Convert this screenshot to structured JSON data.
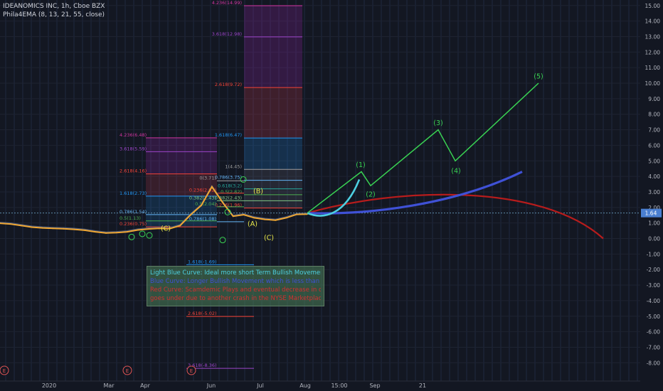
{
  "header": {
    "symbol": "IDEANOMICS INC, 1h, Cboe BZX",
    "indicator": "Phila4EMA (8, 13, 21, 55, close)"
  },
  "price_label": "1.64",
  "note": {
    "line1": "Light Blue Curve: Ideal more short Term Bullish Movement",
    "line2": "Blue Curve: Longer Bullish Movement which is less than ideal",
    "line3": "Red Curve: Scamdemic Plays and eventual decrease in company",
    "line4": "goes under due to another crash in the NYSE Marketplace",
    "color1": "#4dd0e1",
    "color2": "#3f51d6",
    "color3": "#d32f2f"
  },
  "chart_data": {
    "type": "line",
    "y_axis": {
      "ticks": [
        "15.00",
        "14.00",
        "13.00",
        "12.00",
        "11.00",
        "10.00",
        "9.00",
        "8.00",
        "7.00",
        "6.00",
        "5.00",
        "4.00",
        "3.00",
        "2.00",
        "1.00",
        "0.00",
        "-1.00",
        "-2.00",
        "-3.00",
        "-4.00",
        "-5.00",
        "-6.00",
        "-7.00",
        "-8.00"
      ],
      "ylim": [
        -8.6,
        15.3
      ]
    },
    "x_axis": {
      "ticks": [
        "2020",
        "Mar",
        "Apr",
        "Jun",
        "Jul",
        "Aug",
        "15:00",
        "Sep",
        "21"
      ]
    },
    "series": [
      {
        "values": [
          1.05,
          1.0,
          0.9,
          0.8,
          0.75,
          0.72,
          0.7,
          0.66,
          0.6,
          0.5,
          0.42,
          0.45,
          0.5,
          0.62,
          0.68,
          0.72,
          0.7,
          0.9,
          1.6,
          2.2,
          3.4,
          2.4,
          1.5,
          1.6,
          1.4,
          1.3,
          1.25,
          1.4,
          1.62,
          1.64
        ],
        "color": "#f0a733"
      }
    ],
    "projections": [
      {
        "color": "#39d353",
        "points": [
          [
            "Aug",
            1.64
          ],
          [
            "(1)",
            4.3
          ],
          [
            "(2)",
            3.4
          ],
          [
            "(3)",
            7.0
          ],
          [
            "(4)",
            5.0
          ],
          [
            "(5)",
            10.0
          ]
        ]
      },
      {
        "color": "#4dd0e1",
        "points": []
      },
      {
        "color": "#3f51d6",
        "points": []
      },
      {
        "color": "#b71c1c",
        "points": []
      }
    ],
    "wave_labels": [
      {
        "text": "(1)",
        "value": 4.6,
        "color": "#39d353"
      },
      {
        "text": "(2)",
        "value": 2.7,
        "color": "#39d353"
      },
      {
        "text": "(3)",
        "value": 7.3,
        "color": "#39d353"
      },
      {
        "text": "(4)",
        "value": 4.2,
        "color": "#39d353"
      },
      {
        "text": "(5)",
        "value": 10.3,
        "color": "#39d353"
      },
      {
        "text": "(A)",
        "value": 0.8,
        "color": "#e8e84a"
      },
      {
        "text": "(B)",
        "value": 2.9,
        "color": "#e8e84a"
      },
      {
        "text": "(C)",
        "value": 0.5,
        "color": "#e8e84a"
      },
      {
        "text": "(C)",
        "value": -0.1,
        "color": "#e8e84a"
      }
    ],
    "fib_left": [
      {
        "text": "4.236(6.48)",
        "value": 6.48,
        "color": "#d0359f"
      },
      {
        "text": "3.618(5.59)",
        "value": 5.59,
        "color": "#9c45c9"
      },
      {
        "text": "2.618(4.16)",
        "value": 4.16,
        "color": "#f44336"
      },
      {
        "text": "1.618(2.73)",
        "value": 2.73,
        "color": "#2196f3"
      },
      {
        "text": "0.786(1.54)",
        "value": 1.54,
        "color": "#64b5f6"
      },
      {
        "text": "0.5(1.13)",
        "value": 1.13,
        "color": "#4caf50"
      },
      {
        "text": "0.236(0.75)",
        "value": 0.75,
        "color": "#f44336"
      }
    ],
    "fib_right": [
      {
        "text": "4.236(14.99)",
        "value": 14.99,
        "color": "#d0359f"
      },
      {
        "text": "3.618(12.98)",
        "value": 12.98,
        "color": "#9c45c9"
      },
      {
        "text": "2.618(9.72)",
        "value": 9.72,
        "color": "#f44336"
      },
      {
        "text": "1.618(6.47)",
        "value": 6.47,
        "color": "#2196f3"
      },
      {
        "text": "1(4.45)",
        "value": 4.45,
        "color": "#9e9e9e"
      },
      {
        "text": "0.786(3.75)",
        "value": 3.75,
        "color": "#64b5f6"
      },
      {
        "text": "0.618(3.2)",
        "value": 3.2,
        "color": "#26a69a"
      },
      {
        "text": "0.5(2.82)",
        "value": 2.82,
        "color": "#4caf50"
      },
      {
        "text": "0.382(2.43)",
        "value": 2.43,
        "color": "#81c784"
      },
      {
        "text": "0.236(1.96)",
        "value": 1.96,
        "color": "#f44336"
      }
    ],
    "fib_mid": [
      {
        "text": "0(3.71)",
        "value": 3.71,
        "color": "#9e9e9e"
      },
      {
        "text": "0.236(2.92)",
        "value": 2.92,
        "color": "#f44336"
      },
      {
        "text": "0.382(2.43)",
        "value": 2.43,
        "color": "#81c784"
      },
      {
        "text": "0.5(2.04)",
        "value": 2.04,
        "color": "#4caf50"
      },
      {
        "text": "0.786(1.08)",
        "value": 1.08,
        "color": "#64b5f6"
      }
    ],
    "fib_down": [
      {
        "text": "1.618(-1.69)",
        "value": -1.69,
        "color": "#2196f3"
      },
      {
        "text": "2.618(-5.02)",
        "value": -5.02,
        "color": "#f44336"
      },
      {
        "text": "3.618(-8.36)",
        "value": -8.36,
        "color": "#9c45c9"
      }
    ],
    "event_markers": [
      "E",
      "E",
      "E"
    ]
  }
}
